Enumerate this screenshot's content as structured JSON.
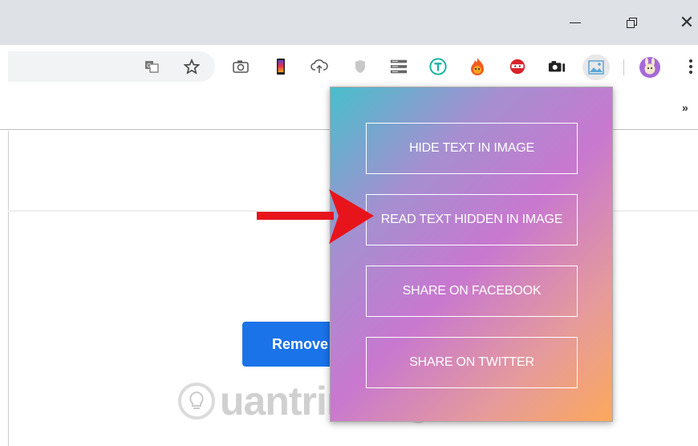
{
  "window": {
    "minimize_glyph": "",
    "close_glyph": "✕"
  },
  "toolbar": {
    "icons": [
      "translate-icon",
      "bookmark-star-icon",
      "camera-icon",
      "phone-icon",
      "upload-cloud-icon",
      "shield-icon",
      "server-icon",
      "t-extension-icon",
      "fire-icon",
      "ninja-icon",
      "camera-dark-icon",
      "image-extension-icon",
      "profile-avatar-icon",
      "menu-icon"
    ]
  },
  "bookmarks": {
    "overflow_glyph": "»"
  },
  "page": {
    "primary_button_label": "Remove"
  },
  "popup": {
    "buttons": [
      {
        "label": "HIDE TEXT IN IMAGE"
      },
      {
        "label": "READ TEXT HIDDEN IN IMAGE"
      },
      {
        "label": "SHARE ON FACEBOOK"
      },
      {
        "label": "SHARE ON TWITTER"
      }
    ]
  },
  "watermark": {
    "text": "uantrimang"
  },
  "colors": {
    "arrow": "#e8141c",
    "primary_button": "#1a73e8",
    "titlebar": "#dee1e6"
  }
}
